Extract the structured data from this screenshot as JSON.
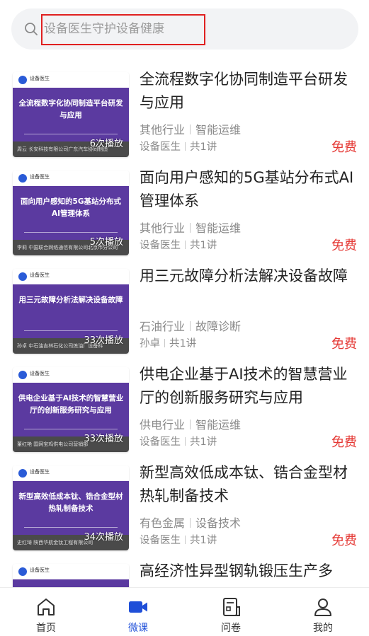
{
  "search": {
    "placeholder": "设备医生守护设备健康"
  },
  "thumb_logo_text": "设备医生",
  "courses": [
    {
      "title": "全流程数字化协同制造平台研发与应用",
      "thumb_title": "全流程数字化协同制造平台研发与应用",
      "thumb_author": "周云 长安科技有限公司广东汽车协同制造",
      "plays": "6次播放",
      "category": "其他行业",
      "tag": "智能运维",
      "author": "设备医生",
      "lessons": "共1讲",
      "price": "免费"
    },
    {
      "title": "面向用户感知的5G基站分布式AI管理体系",
      "thumb_title": "面向用户感知的5G基站分布式AI管理体系",
      "thumb_author": "李莉 中国联合网络通信有限公司北京市分公司",
      "plays": "5次播放",
      "category": "其他行业",
      "tag": "智能运维",
      "author": "设备医生",
      "lessons": "共1讲",
      "price": "免费"
    },
    {
      "title": "用三元故障分析法解决设备故障",
      "thumb_title": "用三元故障分析法解决设备故障",
      "thumb_author": "孙卓 中石油吉林石化公司炼油厂设备科",
      "plays": "33次播放",
      "category": "石油行业",
      "tag": "故障诊断",
      "author": "孙卓",
      "lessons": "共1讲",
      "price": "免费"
    },
    {
      "title": "供电企业基于AI技术的智慧营业厅的创新服务研究与应用",
      "thumb_title": "供电企业基于AI技术的智慧营业厅的创新服务研究与应用",
      "thumb_author": "董红艳 国网宝鸡供电公司营销部",
      "plays": "33次播放",
      "category": "供电行业",
      "tag": "智能运维",
      "author": "设备医生",
      "lessons": "共1讲",
      "price": "免费"
    },
    {
      "title": "新型高效低成本钛、锆合金型材热轧制备技术",
      "thumb_title": "新型高效低成本钛、锆合金型材热轧制备技术",
      "thumb_author": "史红琦 陕西华航金钛工程有限公司",
      "plays": "34次播放",
      "category": "有色金属",
      "tag": "设备技术",
      "author": "设备医生",
      "lessons": "共1讲",
      "price": "免费"
    },
    {
      "title": "高经济性异型钢轨锻压生产多",
      "thumb_title": "",
      "thumb_author": "",
      "plays": "",
      "category": "",
      "tag": "",
      "author": "",
      "lessons": "",
      "price": ""
    }
  ],
  "tabbar": [
    {
      "label": "首页",
      "icon": "home-icon"
    },
    {
      "label": "微课",
      "icon": "video-camera-icon"
    },
    {
      "label": "问卷",
      "icon": "questionnaire-icon"
    },
    {
      "label": "我的",
      "icon": "user-icon"
    }
  ],
  "colors": {
    "accent": "#1f4fd8",
    "price": "#e53935",
    "thumb_bg": "#5b3aa0"
  }
}
